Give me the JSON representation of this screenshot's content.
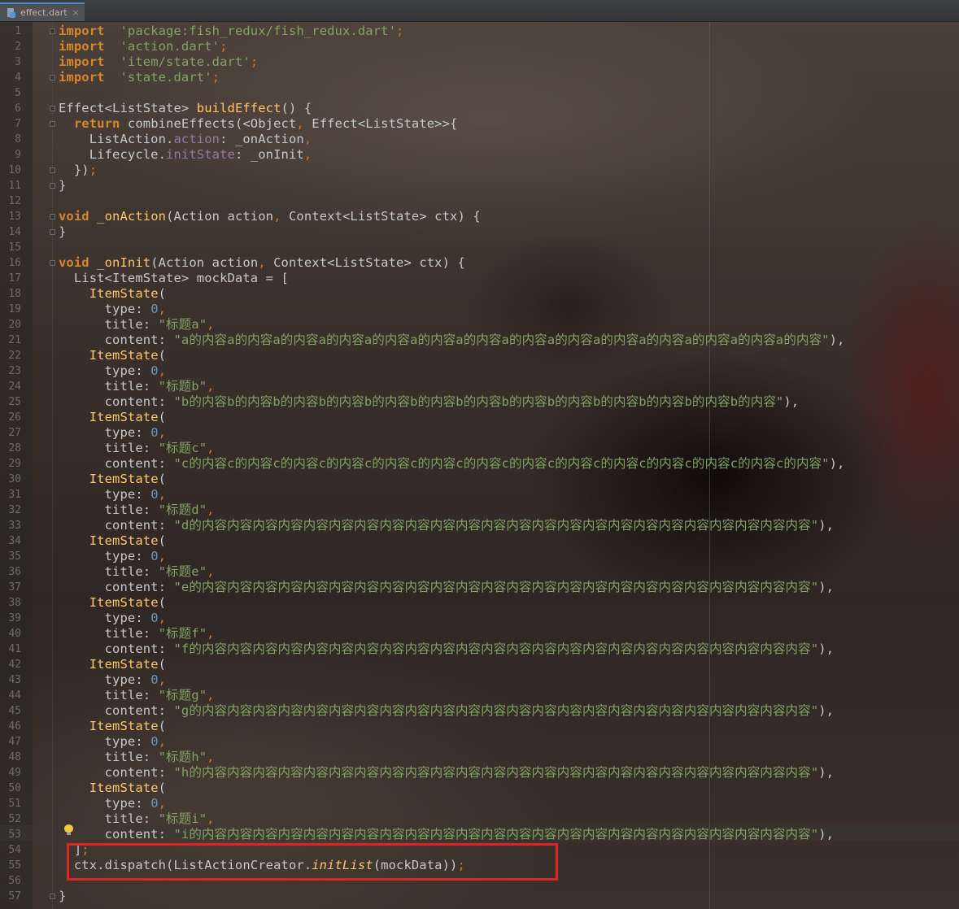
{
  "tab": {
    "name": "effect.dart",
    "close": "×"
  },
  "lines": [
    {
      "n": "1",
      "t": [
        [
          "kw",
          "import"
        ],
        [
          "",
          "  "
        ],
        [
          "str",
          "'package:fish_redux/fish_redux.dart'"
        ],
        [
          "punct",
          ";"
        ]
      ]
    },
    {
      "n": "2",
      "t": [
        [
          "kw",
          "import"
        ],
        [
          "",
          "  "
        ],
        [
          "str",
          "'action.dart'"
        ],
        [
          "punct",
          ";"
        ]
      ]
    },
    {
      "n": "3",
      "t": [
        [
          "kw",
          "import"
        ],
        [
          "",
          "  "
        ],
        [
          "str",
          "'item/state.dart'"
        ],
        [
          "punct",
          ";"
        ]
      ]
    },
    {
      "n": "4",
      "t": [
        [
          "kw",
          "import"
        ],
        [
          "",
          "  "
        ],
        [
          "str",
          "'state.dart'"
        ],
        [
          "punct",
          ";"
        ]
      ]
    },
    {
      "n": "5",
      "t": []
    },
    {
      "n": "6",
      "t": [
        [
          "",
          "Effect<ListState> "
        ],
        [
          "fn",
          "buildEffect"
        ],
        [
          "",
          "() {"
        ]
      ]
    },
    {
      "n": "7",
      "t": [
        [
          "",
          "  "
        ],
        [
          "kw",
          "return"
        ],
        [
          "",
          " combineEffects(<Object"
        ],
        [
          "punct",
          ","
        ],
        [
          "",
          " Effect<ListState>>{"
        ]
      ]
    },
    {
      "n": "8",
      "t": [
        [
          "",
          "    ListAction."
        ],
        [
          "prop",
          "action"
        ],
        [
          "",
          ": _onAction"
        ],
        [
          "punct",
          ","
        ]
      ]
    },
    {
      "n": "9",
      "t": [
        [
          "",
          "    Lifecycle."
        ],
        [
          "prop",
          "initState"
        ],
        [
          "",
          ": _onInit"
        ],
        [
          "punct",
          ","
        ]
      ]
    },
    {
      "n": "10",
      "t": [
        [
          "",
          "  })"
        ],
        [
          "punct",
          ";"
        ]
      ]
    },
    {
      "n": "11",
      "t": [
        [
          "",
          "}"
        ]
      ]
    },
    {
      "n": "12",
      "t": []
    },
    {
      "n": "13",
      "t": [
        [
          "kw",
          "void"
        ],
        [
          "",
          " "
        ],
        [
          "fn",
          "_onAction"
        ],
        [
          "",
          "(Action action"
        ],
        [
          "punct",
          ","
        ],
        [
          "",
          " Context<ListState> ctx) {"
        ]
      ]
    },
    {
      "n": "14",
      "t": [
        [
          "",
          "}"
        ]
      ]
    },
    {
      "n": "15",
      "t": []
    },
    {
      "n": "16",
      "t": [
        [
          "kw",
          "void"
        ],
        [
          "",
          " "
        ],
        [
          "fn",
          "_onInit"
        ],
        [
          "",
          "(Action action"
        ],
        [
          "punct",
          ","
        ],
        [
          "",
          " Context<ListState> ctx) {"
        ]
      ]
    },
    {
      "n": "17",
      "t": [
        [
          "",
          "  List<ItemState> mockData = ["
        ]
      ]
    },
    {
      "n": "18",
      "t": [
        [
          "",
          "    "
        ],
        [
          "fn",
          "ItemState"
        ],
        [
          "",
          "("
        ]
      ]
    },
    {
      "n": "19",
      "t": [
        [
          "",
          "      type: "
        ],
        [
          "num",
          "0"
        ],
        [
          "punct",
          ","
        ]
      ]
    },
    {
      "n": "20",
      "t": [
        [
          "",
          "      title: "
        ],
        [
          "str",
          "\"标题a\""
        ],
        [
          "punct",
          ","
        ]
      ]
    },
    {
      "n": "21",
      "t": [
        [
          "",
          "      content: "
        ],
        [
          "str",
          "\"a的内容a的内容a的内容a的内容a的内容a的内容a的内容a的内容a的内容a的内容a的内容a的内容a的内容a的内容\""
        ],
        [
          "",
          "),"
        ]
      ]
    },
    {
      "n": "22",
      "t": [
        [
          "",
          "    "
        ],
        [
          "fn",
          "ItemState"
        ],
        [
          "",
          "("
        ]
      ]
    },
    {
      "n": "23",
      "t": [
        [
          "",
          "      type: "
        ],
        [
          "num",
          "0"
        ],
        [
          "punct",
          ","
        ]
      ]
    },
    {
      "n": "24",
      "t": [
        [
          "",
          "      title: "
        ],
        [
          "str",
          "\"标题b\""
        ],
        [
          "punct",
          ","
        ]
      ]
    },
    {
      "n": "25",
      "t": [
        [
          "",
          "      content: "
        ],
        [
          "str",
          "\"b的内容b的内容b的内容b的内容b的内容b的内容b的内容b的内容b的内容b的内容b的内容b的内容b的内容\""
        ],
        [
          "",
          "),"
        ]
      ]
    },
    {
      "n": "26",
      "t": [
        [
          "",
          "    "
        ],
        [
          "fn",
          "ItemState"
        ],
        [
          "",
          "("
        ]
      ]
    },
    {
      "n": "27",
      "t": [
        [
          "",
          "      type: "
        ],
        [
          "num",
          "0"
        ],
        [
          "punct",
          ","
        ]
      ]
    },
    {
      "n": "28",
      "t": [
        [
          "",
          "      title: "
        ],
        [
          "str",
          "\"标题c\""
        ],
        [
          "punct",
          ","
        ]
      ]
    },
    {
      "n": "29",
      "t": [
        [
          "",
          "      content: "
        ],
        [
          "str",
          "\"c的内容c的内容c的内容c的内容c的内容c的内容c的内容c的内容c的内容c的内容c的内容c的内容c的内容c的内容\""
        ],
        [
          "",
          "),"
        ]
      ]
    },
    {
      "n": "30",
      "t": [
        [
          "",
          "    "
        ],
        [
          "fn",
          "ItemState"
        ],
        [
          "",
          "("
        ]
      ]
    },
    {
      "n": "31",
      "t": [
        [
          "",
          "      type: "
        ],
        [
          "num",
          "0"
        ],
        [
          "punct",
          ","
        ]
      ]
    },
    {
      "n": "32",
      "t": [
        [
          "",
          "      title: "
        ],
        [
          "str",
          "\"标题d\""
        ],
        [
          "punct",
          ","
        ]
      ]
    },
    {
      "n": "33",
      "t": [
        [
          "",
          "      content: "
        ],
        [
          "str",
          "\"d的内容内容内容内容内容内容内容内容内容内容内容内容内容内容内容内容内容内容内容内容内容内容内容内容\""
        ],
        [
          "",
          "),"
        ]
      ]
    },
    {
      "n": "34",
      "t": [
        [
          "",
          "    "
        ],
        [
          "fn",
          "ItemState"
        ],
        [
          "",
          "("
        ]
      ]
    },
    {
      "n": "35",
      "t": [
        [
          "",
          "      type: "
        ],
        [
          "num",
          "0"
        ],
        [
          "punct",
          ","
        ]
      ]
    },
    {
      "n": "36",
      "t": [
        [
          "",
          "      title: "
        ],
        [
          "str",
          "\"标题e\""
        ],
        [
          "punct",
          ","
        ]
      ]
    },
    {
      "n": "37",
      "t": [
        [
          "",
          "      content: "
        ],
        [
          "str",
          "\"e的内容内容内容内容内容内容内容内容内容内容内容内容内容内容内容内容内容内容内容内容内容内容内容内容\""
        ],
        [
          "",
          "),"
        ]
      ]
    },
    {
      "n": "38",
      "t": [
        [
          "",
          "    "
        ],
        [
          "fn",
          "ItemState"
        ],
        [
          "",
          "("
        ]
      ]
    },
    {
      "n": "39",
      "t": [
        [
          "",
          "      type: "
        ],
        [
          "num",
          "0"
        ],
        [
          "punct",
          ","
        ]
      ]
    },
    {
      "n": "40",
      "t": [
        [
          "",
          "      title: "
        ],
        [
          "str",
          "\"标题f\""
        ],
        [
          "punct",
          ","
        ]
      ]
    },
    {
      "n": "41",
      "t": [
        [
          "",
          "      content: "
        ],
        [
          "str",
          "\"f的内容内容内容内容内容内容内容内容内容内容内容内容内容内容内容内容内容内容内容内容内容内容内容内容\""
        ],
        [
          "",
          "),"
        ]
      ]
    },
    {
      "n": "42",
      "t": [
        [
          "",
          "    "
        ],
        [
          "fn",
          "ItemState"
        ],
        [
          "",
          "("
        ]
      ]
    },
    {
      "n": "43",
      "t": [
        [
          "",
          "      type: "
        ],
        [
          "num",
          "0"
        ],
        [
          "punct",
          ","
        ]
      ]
    },
    {
      "n": "44",
      "t": [
        [
          "",
          "      title: "
        ],
        [
          "str",
          "\"标题g\""
        ],
        [
          "punct",
          ","
        ]
      ]
    },
    {
      "n": "45",
      "t": [
        [
          "",
          "      content: "
        ],
        [
          "str",
          "\"g的内容内容内容内容内容内容内容内容内容内容内容内容内容内容内容内容内容内容内容内容内容内容内容内容\""
        ],
        [
          "",
          "),"
        ]
      ]
    },
    {
      "n": "46",
      "t": [
        [
          "",
          "    "
        ],
        [
          "fn",
          "ItemState"
        ],
        [
          "",
          "("
        ]
      ]
    },
    {
      "n": "47",
      "t": [
        [
          "",
          "      type: "
        ],
        [
          "num",
          "0"
        ],
        [
          "punct",
          ","
        ]
      ]
    },
    {
      "n": "48",
      "t": [
        [
          "",
          "      title: "
        ],
        [
          "str",
          "\"标题h\""
        ],
        [
          "punct",
          ","
        ]
      ]
    },
    {
      "n": "49",
      "t": [
        [
          "",
          "      content: "
        ],
        [
          "str",
          "\"h的内容内容内容内容内容内容内容内容内容内容内容内容内容内容内容内容内容内容内容内容内容内容内容内容\""
        ],
        [
          "",
          "),"
        ]
      ]
    },
    {
      "n": "50",
      "t": [
        [
          "",
          "    "
        ],
        [
          "fn",
          "ItemState"
        ],
        [
          "",
          "("
        ]
      ]
    },
    {
      "n": "51",
      "t": [
        [
          "",
          "      type: "
        ],
        [
          "num",
          "0"
        ],
        [
          "punct",
          ","
        ]
      ]
    },
    {
      "n": "52",
      "t": [
        [
          "",
          "      title: "
        ],
        [
          "str",
          "\"标题i\""
        ],
        [
          "punct",
          ","
        ]
      ]
    },
    {
      "n": "53",
      "t": [
        [
          "",
          "      content: "
        ],
        [
          "str",
          "\"i的内容内容内容内容内容内容内容内容内容内容内容内容内容内容内容内容内容内容内容内容内容内容内容内容\""
        ],
        [
          "",
          "),"
        ]
      ]
    },
    {
      "n": "54",
      "t": [
        [
          "",
          "  ]"
        ],
        [
          "punct",
          ";"
        ]
      ]
    },
    {
      "n": "55",
      "t": [
        [
          "",
          "  ctx.dispatch(ListActionCreator."
        ],
        [
          "ital",
          "initList"
        ],
        [
          "",
          "(mockData))"
        ],
        [
          "punct",
          ";"
        ]
      ]
    },
    {
      "n": "56",
      "t": []
    },
    {
      "n": "57",
      "t": [
        [
          "",
          "}"
        ]
      ]
    }
  ]
}
